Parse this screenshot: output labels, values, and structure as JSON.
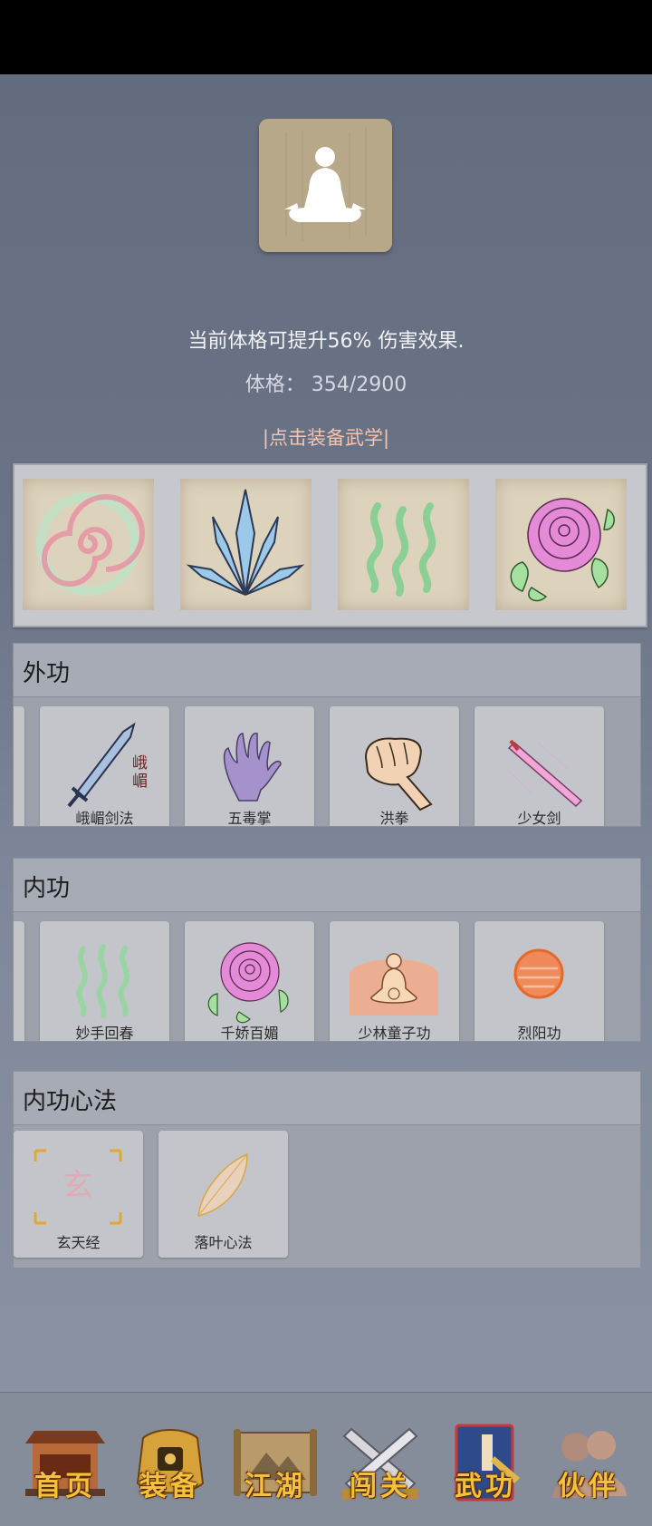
{
  "profile": {
    "bonus_text": "当前体格可提升56% 伤害效果.",
    "stat_label": "体格：",
    "stat_value": "354/2900",
    "equip_link": "|点击装备武学|"
  },
  "equipped": [
    {
      "icon": "pink-swirl-icon"
    },
    {
      "icon": "ice-crystal-icon"
    },
    {
      "icon": "green-waves-icon"
    },
    {
      "icon": "pink-rose-icon"
    }
  ],
  "sections": {
    "waigong": {
      "title": "外功",
      "items": [
        {
          "label": "峨嵋剑法",
          "icon": "emei-sword-icon"
        },
        {
          "label": "五毒掌",
          "icon": "purple-palm-icon"
        },
        {
          "label": "洪拳",
          "icon": "fist-icon"
        },
        {
          "label": "少女剑",
          "icon": "pink-sword-icon"
        }
      ]
    },
    "neigong": {
      "title": "内功",
      "items": [
        {
          "label": "妙手回春",
          "icon": "green-waves-icon"
        },
        {
          "label": "千娇百媚",
          "icon": "pink-rose-icon"
        },
        {
          "label": "少林童子功",
          "icon": "meditating-monk-icon"
        },
        {
          "label": "烈阳功",
          "icon": "sun-orb-icon"
        }
      ]
    },
    "xinfa": {
      "title": "内功心法",
      "items": [
        {
          "label": "玄天经",
          "icon": "xuan-seal-icon",
          "seal_char": "玄"
        },
        {
          "label": "落叶心法",
          "icon": "leaf-icon"
        }
      ]
    }
  },
  "emei_glyph": "峨\n嵋",
  "nav": [
    {
      "label": "首页",
      "icon": "temple-gate-icon"
    },
    {
      "label": "装备",
      "icon": "gold-armor-icon"
    },
    {
      "label": "江湖",
      "icon": "scroll-map-icon"
    },
    {
      "label": "闯关",
      "icon": "crossed-swords-icon"
    },
    {
      "label": "武功",
      "icon": "martial-book-icon"
    },
    {
      "label": "伙伴",
      "icon": "companions-icon"
    }
  ],
  "colors": {
    "accent_link": "#f4c4b2",
    "nav_label": "#f3c23a"
  }
}
